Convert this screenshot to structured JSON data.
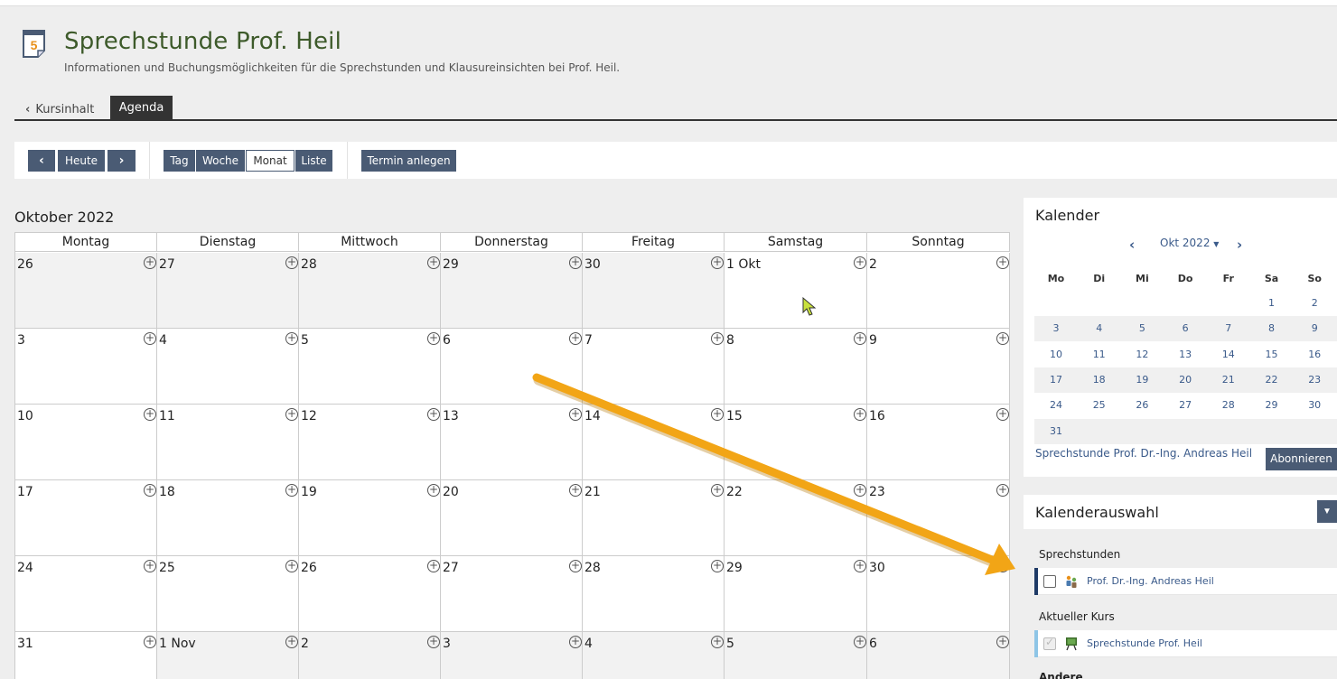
{
  "page": {
    "title": "Sprechstunde Prof. Heil",
    "subtitle": "Informationen und Buchungsmöglichkeiten für die Sprechstunden und Klausureinsichten bei Prof. Heil.",
    "course_icon_number": "5"
  },
  "tabs": {
    "back_label": "Kursinhalt",
    "active_label": "Agenda"
  },
  "toolbar": {
    "today_label": "Heute",
    "view_day": "Tag",
    "view_week": "Woche",
    "view_month": "Monat",
    "view_list": "Liste",
    "selected_view": "Monat",
    "create_label": "Termin anlegen"
  },
  "calendar": {
    "month_title": "Oktober 2022",
    "weekdays": [
      "Montag",
      "Dienstag",
      "Mittwoch",
      "Donnerstag",
      "Freitag",
      "Samstag",
      "Sonntag"
    ],
    "weeks": [
      [
        "26",
        "27",
        "28",
        "29",
        "30",
        "1 Okt",
        "2"
      ],
      [
        "3",
        "4",
        "5",
        "6",
        "7",
        "8",
        "9"
      ],
      [
        "10",
        "11",
        "12",
        "13",
        "14",
        "15",
        "16"
      ],
      [
        "17",
        "18",
        "19",
        "20",
        "21",
        "22",
        "23"
      ],
      [
        "24",
        "25",
        "26",
        "27",
        "28",
        "29",
        "30"
      ],
      [
        "31",
        "1 Nov",
        "2",
        "3",
        "4",
        "5",
        "6"
      ]
    ],
    "add_icon": "+"
  },
  "mini_calendar": {
    "heading": "Kalender",
    "month_label": "Okt 2022",
    "weekdays": [
      "Mo",
      "Di",
      "Mi",
      "Do",
      "Fr",
      "Sa",
      "So"
    ],
    "weeks": [
      [
        "",
        "",
        "",
        "",
        "",
        "1",
        "2"
      ],
      [
        "3",
        "4",
        "5",
        "6",
        "7",
        "8",
        "9"
      ],
      [
        "10",
        "11",
        "12",
        "13",
        "14",
        "15",
        "16"
      ],
      [
        "17",
        "18",
        "19",
        "20",
        "21",
        "22",
        "23"
      ],
      [
        "24",
        "25",
        "26",
        "27",
        "28",
        "29",
        "30"
      ],
      [
        "31",
        "",
        "",
        "",
        "",
        "",
        ""
      ]
    ],
    "feed_link": "Sprechstunde Prof. Dr.-Ing. Andreas Heil",
    "subscribe_label": "Abonnieren"
  },
  "calendar_selection": {
    "heading": "Kalenderauswahl",
    "groups": [
      {
        "label": "Sprechstunden",
        "entry": "Prof. Dr.-Ing. Andreas Heil",
        "checked": false,
        "color": "#1f3a66",
        "icon": "user-group-icon"
      },
      {
        "label": "Aktueller Kurs",
        "entry": "Sprechstunde Prof. Heil",
        "checked": true,
        "color": "#8ec5e6",
        "icon": "presentation-board-icon"
      }
    ],
    "more_label": "Andere"
  },
  "colors": {
    "accent_button": "#4a5b74",
    "title_green": "#3d5a2a",
    "annotation_arrow": "#f2a516",
    "cursor": "#c8e03c"
  }
}
